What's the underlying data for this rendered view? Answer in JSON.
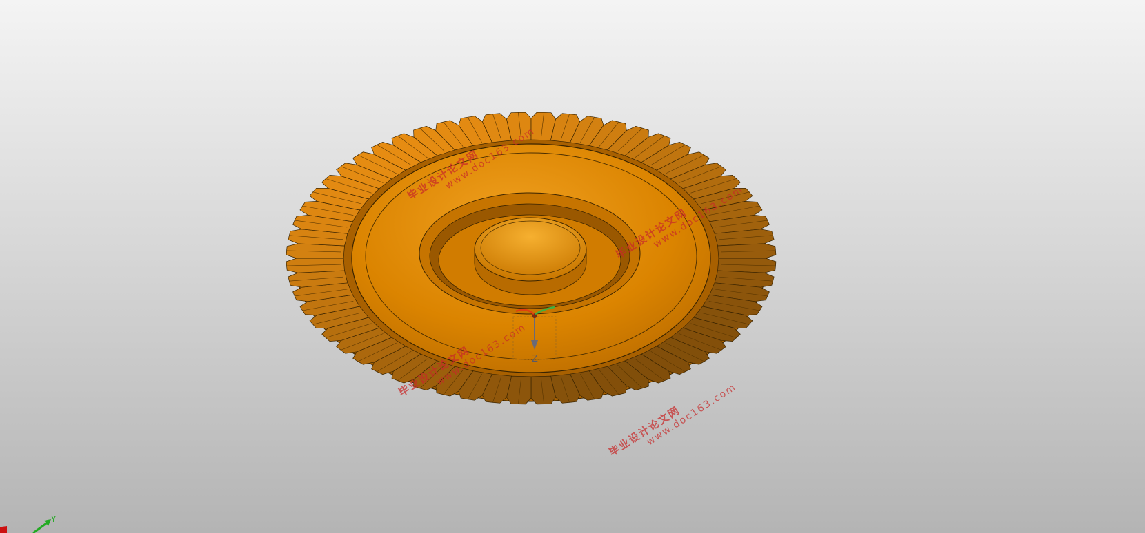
{
  "viewport": {
    "background_top": "#f4f4f4",
    "background_bottom": "#b4b4b4"
  },
  "model": {
    "color": "#d98200",
    "edge_color": "#3a2400",
    "tooth_count": 60
  },
  "origin_marker": {
    "axis_label": "Z"
  },
  "watermarks": [
    {
      "cn": "毕业设计论文网",
      "url": "www.doc163.com"
    },
    {
      "cn": "毕业设计论文网",
      "url": "www.doc163.com"
    },
    {
      "cn": "毕业设计论文网",
      "url": "www.doc163.com"
    },
    {
      "cn": "毕业设计论文网",
      "url": "www.doc163.com"
    }
  ],
  "triad": {
    "y_label": "Y",
    "x_color": "#cc1111",
    "y_color": "#22aa22"
  }
}
